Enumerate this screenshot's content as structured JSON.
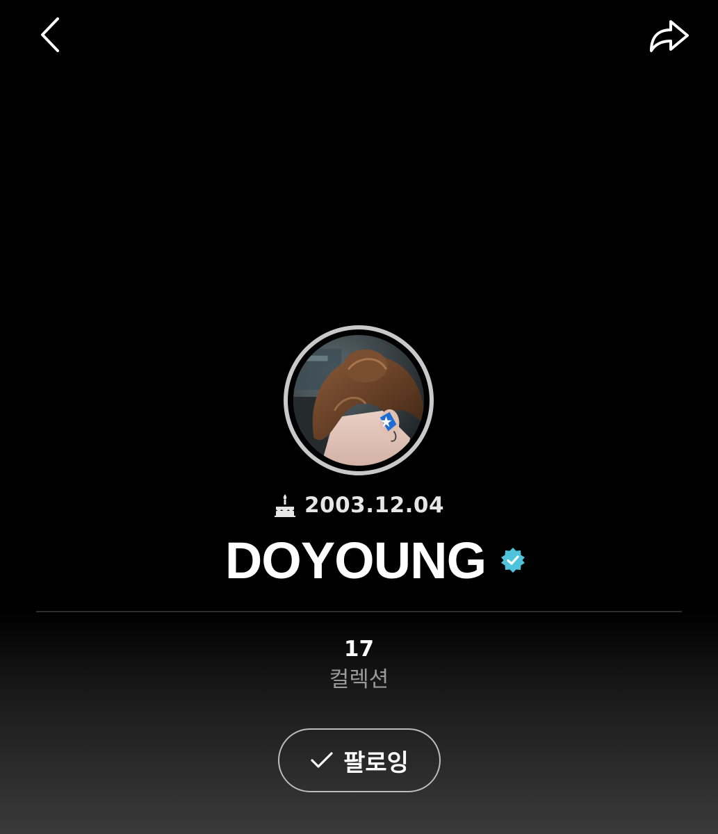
{
  "header": {
    "back_icon": "chevron-left-icon",
    "share_icon": "share-arrow-icon"
  },
  "profile": {
    "avatar_icon": "profile-photo",
    "birthday_icon": "cake-icon",
    "birthday": "2003.12.04",
    "name": "DOYOUNG",
    "verified_icon": "verified-badge-icon",
    "verified_color": "#4fc3dc"
  },
  "stats": {
    "collections_count": "17",
    "collections_label": "컬렉션"
  },
  "follow": {
    "check_icon": "check-icon",
    "label": "팔로잉"
  }
}
